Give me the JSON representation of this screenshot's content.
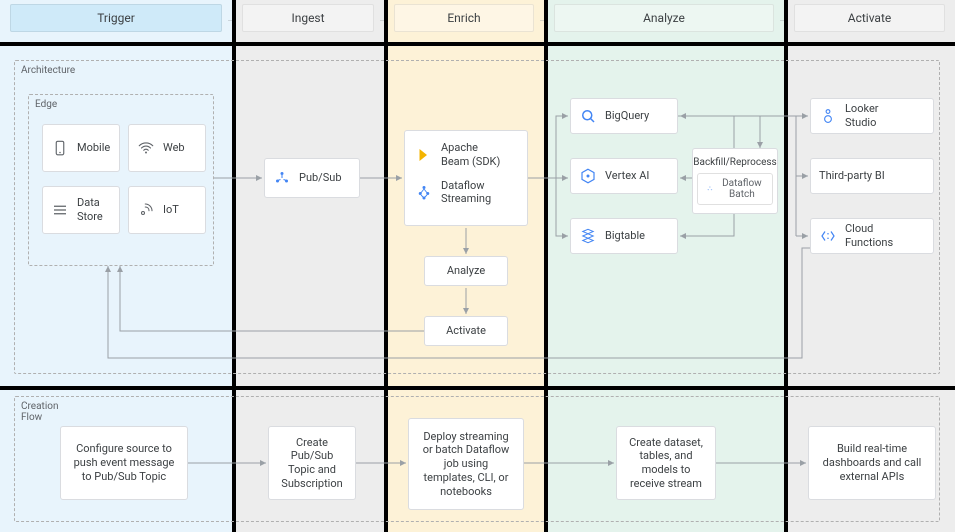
{
  "columns": {
    "trigger": "Trigger",
    "ingest": "Ingest",
    "enrich": "Enrich",
    "analyze": "Analyze",
    "activate": "Activate"
  },
  "panels": {
    "architecture": "Architecture",
    "edge": "Edge",
    "creation_flow": "Creation\nFlow"
  },
  "edge": {
    "mobile": "Mobile",
    "web": "Web",
    "datastore": "Data\nStore",
    "iot": "IoT"
  },
  "ingest": {
    "pubsub": "Pub/Sub"
  },
  "enrich": {
    "beam": "Apache\nBeam (SDK)",
    "dataflow_streaming": "Dataflow\nStreaming",
    "analyze": "Analyze",
    "activate": "Activate"
  },
  "analyze": {
    "bigquery": "BigQuery",
    "vertex": "Vertex AI",
    "bigtable": "Bigtable",
    "backfill": "Backfill/Reprocess",
    "dataflow_batch": "Dataflow Batch"
  },
  "activate": {
    "looker": "Looker\nStudio",
    "thirdparty": "Third-party BI",
    "cloudfn": "Cloud\nFunctions"
  },
  "creation": {
    "trigger": "Configure source to push event message to Pub/Sub Topic",
    "ingest": "Create Pub/Sub Topic and Subscription",
    "enrich": "Deploy streaming or batch Dataflow job using templates, CLI, or notebooks",
    "analyze": "Create dataset, tables, and models to receive stream",
    "activate": "Build real-time dashboards and call external APIs"
  }
}
